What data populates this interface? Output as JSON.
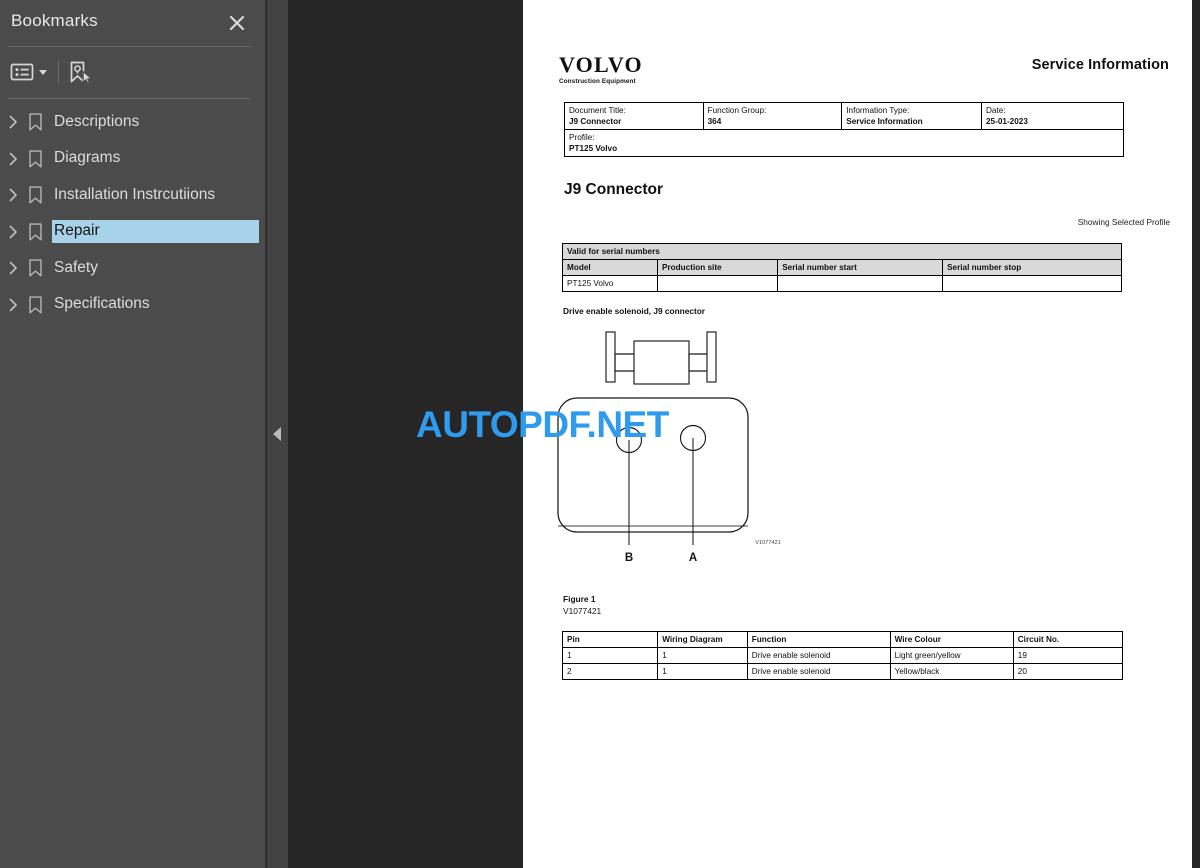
{
  "sidebar": {
    "title": "Bookmarks",
    "close_icon": "close-icon",
    "toolbar": {
      "options_icon": "list-options-icon",
      "new_bookmark_icon": "new-bookmark-icon"
    },
    "items": [
      {
        "label": "Descriptions",
        "selected": false
      },
      {
        "label": "Diagrams",
        "selected": false
      },
      {
        "label": "Installation Instrcutiions",
        "selected": false
      },
      {
        "label": "Repair",
        "selected": true
      },
      {
        "label": "Safety",
        "selected": false
      },
      {
        "label": "Specifications",
        "selected": false
      }
    ],
    "selection_color": "#a8d1ea"
  },
  "viewer": {
    "collapse_arrow_icon": "collapse-left-icon",
    "watermark": "AUTOPDF.NET",
    "watermark_color": "#2f9bee",
    "background_color": "#262626"
  },
  "document": {
    "brand": "VOLVO",
    "brand_subtitle": "Construction Equipment",
    "header_right": "Service Information",
    "meta_table": {
      "labels": [
        "Document Title:",
        "Function Group:",
        "Information Type:",
        "Date:"
      ],
      "values": [
        "J9 Connector",
        "364",
        "Service Information",
        "25-01-2023"
      ],
      "profile_label": "Profile:",
      "profile_value": "PT125 Volvo"
    },
    "title": "J9 Connector",
    "showing_profile": "Showing Selected Profile",
    "serial_table": {
      "caption": "Valid for serial numbers",
      "columns": [
        "Model",
        "Production site",
        "Serial number start",
        "Serial number stop"
      ],
      "rows": [
        [
          "PT125 Volvo",
          "",
          "",
          ""
        ]
      ]
    },
    "figure_caption": "Drive enable solenoid, J9 connector",
    "figure_pins": [
      "B",
      "A"
    ],
    "figure_code_inline": "V1077421",
    "figure_label": "Figure 1",
    "figure_id": "V1077421",
    "pin_table": {
      "columns": [
        "Pin",
        "Wiring Diagram",
        "Function",
        "Wire Colour",
        "Circuit No."
      ],
      "rows": [
        [
          "1",
          "1",
          "Drive enable solenoid",
          "Light green/yellow",
          "19"
        ],
        [
          "2",
          "1",
          "Drive enable solenoid",
          "Yellow/black",
          "20"
        ]
      ]
    }
  }
}
